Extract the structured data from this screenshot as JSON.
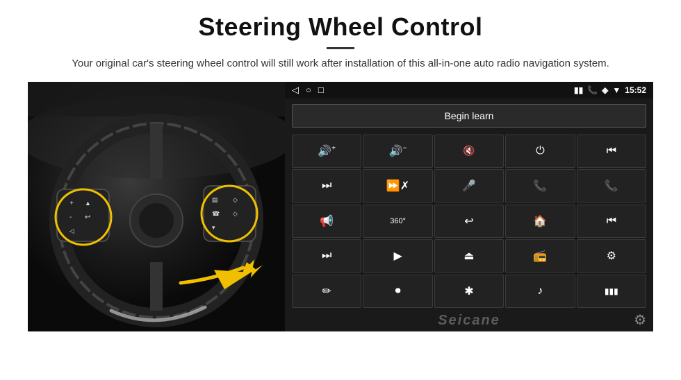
{
  "header": {
    "title": "Steering Wheel Control",
    "subtitle": "Your original car's steering wheel control will still work after installation of this all-in-one auto radio navigation system."
  },
  "status_bar": {
    "nav_back": "◁",
    "nav_home": "○",
    "nav_square": "□",
    "signal": "▮▮",
    "phone_icon": "📞",
    "location_icon": "◈",
    "wifi_icon": "▼",
    "time": "15:52"
  },
  "begin_learn": {
    "label": "Begin learn"
  },
  "controls": [
    {
      "icon": "🔊+",
      "symbol": "vol_up",
      "unicode": ""
    },
    {
      "icon": "🔊-",
      "symbol": "vol_down",
      "unicode": ""
    },
    {
      "icon": "🔇",
      "symbol": "mute",
      "unicode": ""
    },
    {
      "icon": "⏻",
      "symbol": "power",
      "unicode": ""
    },
    {
      "icon": "⏮",
      "symbol": "prev_track",
      "unicode": ""
    },
    {
      "icon": "⏭",
      "symbol": "next",
      "unicode": ""
    },
    {
      "icon": "⏩",
      "symbol": "fast_fwd",
      "unicode": ""
    },
    {
      "icon": "🎤",
      "symbol": "mic",
      "unicode": ""
    },
    {
      "icon": "📞",
      "symbol": "call",
      "unicode": ""
    },
    {
      "icon": "📞",
      "symbol": "end_call",
      "unicode": ""
    },
    {
      "icon": "📢",
      "symbol": "horn",
      "unicode": ""
    },
    {
      "icon": "360",
      "symbol": "cam360",
      "unicode": ""
    },
    {
      "icon": "↩",
      "symbol": "back",
      "unicode": ""
    },
    {
      "icon": "🏠",
      "symbol": "home",
      "unicode": ""
    },
    {
      "icon": "⏮",
      "symbol": "rew",
      "unicode": ""
    },
    {
      "icon": "⏭",
      "symbol": "next2",
      "unicode": ""
    },
    {
      "icon": "▶",
      "symbol": "play",
      "unicode": ""
    },
    {
      "icon": "⏺",
      "symbol": "rec",
      "unicode": ""
    },
    {
      "icon": "📻",
      "symbol": "radio",
      "unicode": ""
    },
    {
      "icon": "⚙",
      "symbol": "eq",
      "unicode": ""
    },
    {
      "icon": "✏",
      "symbol": "edit",
      "unicode": ""
    },
    {
      "icon": "⏺",
      "symbol": "disc",
      "unicode": ""
    },
    {
      "icon": "✱",
      "symbol": "bt",
      "unicode": ""
    },
    {
      "icon": "♪",
      "symbol": "music",
      "unicode": ""
    },
    {
      "icon": "▮▮▮",
      "symbol": "spectrum",
      "unicode": ""
    }
  ],
  "brand": {
    "name": "Seicane"
  },
  "icons": {
    "settings": "⚙"
  }
}
